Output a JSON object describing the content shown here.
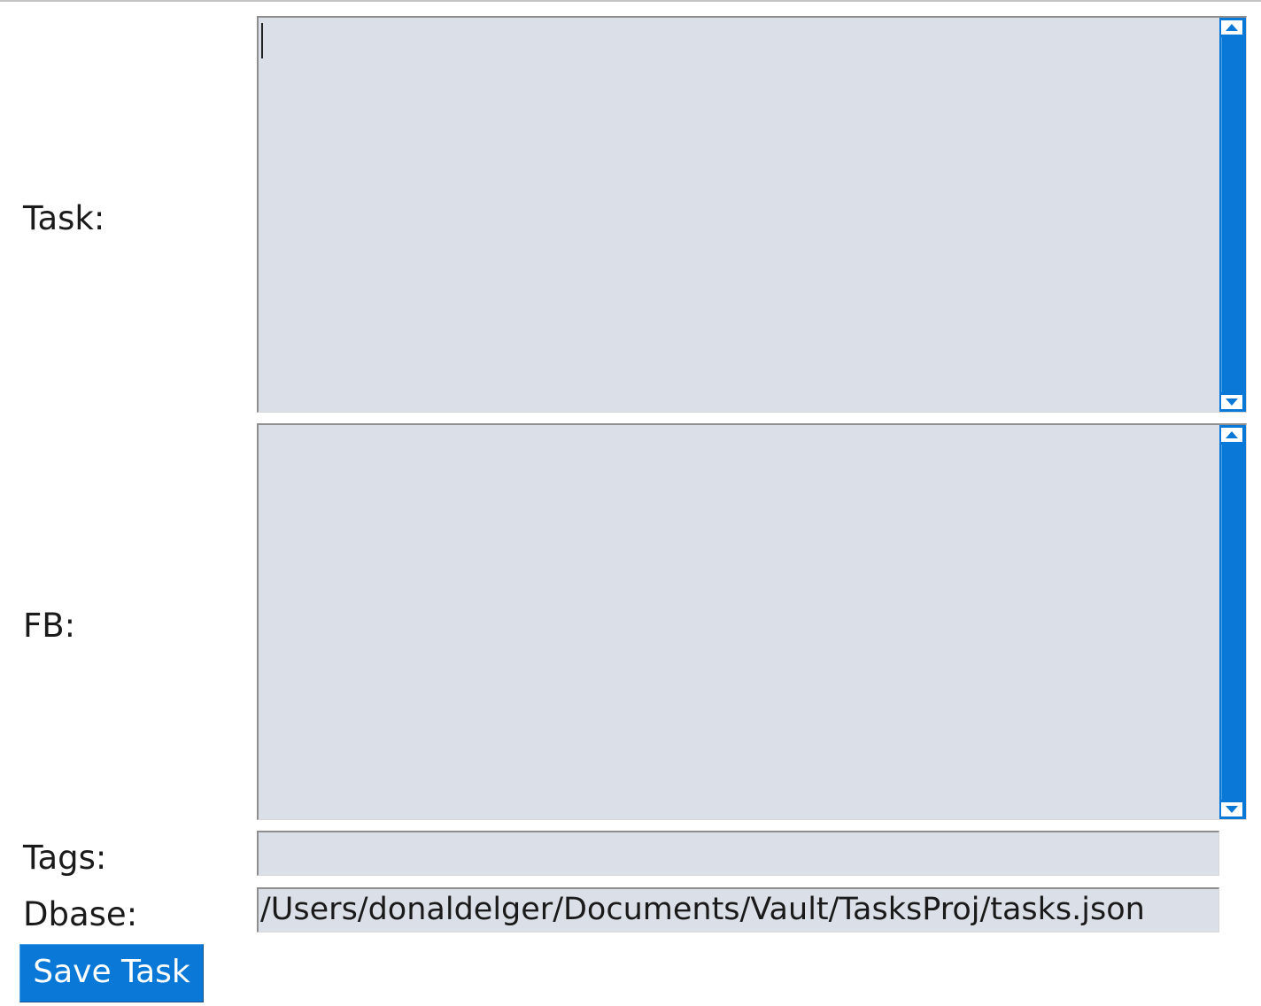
{
  "form": {
    "task": {
      "label": "Task:",
      "value": ""
    },
    "fb": {
      "label": "FB:",
      "value": ""
    },
    "tags": {
      "label": "Tags:",
      "value": ""
    },
    "dbase": {
      "label": "Dbase:",
      "value": "/Users/donaldelger/Documents/Vault/TasksProj/tasks.json"
    },
    "save_label": "Save Task"
  },
  "colors": {
    "field_bg": "#dbe0e8",
    "accent": "#0a78d7"
  },
  "icons": {
    "scroll_up": "scroll-up-arrow-icon",
    "scroll_down": "scroll-down-arrow-icon"
  }
}
